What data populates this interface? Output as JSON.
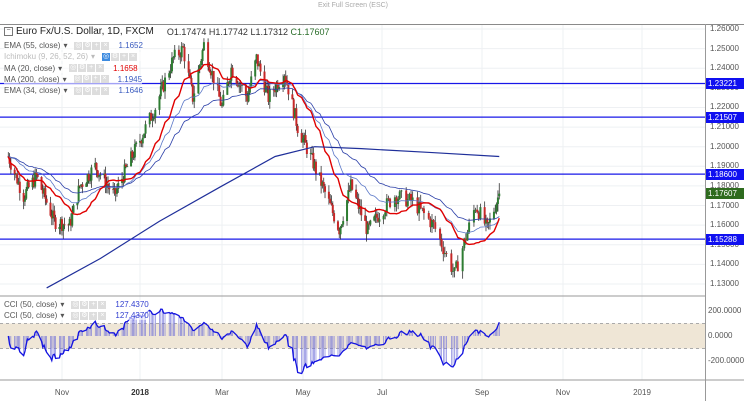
{
  "topbar": {
    "exit_fullscreen": "Exit Full Screen (ESC)"
  },
  "header": {
    "symbol": "Euro Fx/U.S. Dollar, 1D, FXCM",
    "open": "O1.17474",
    "high": "H1.17742",
    "low": "L1.17312",
    "close": "C1.17607"
  },
  "indicators": [
    {
      "label": "EMA (55, close)",
      "value": "1.1652",
      "color": "#3a5bbf",
      "faded": false
    },
    {
      "label": "Ichimoku (9, 26, 52, 26)",
      "value": "",
      "color": "#bbb",
      "faded": true
    },
    {
      "label": "MA (20, close)",
      "value": "1.1658",
      "color": "#e00000",
      "faded": false
    },
    {
      "label": "MA (200, close)",
      "value": "1.1945",
      "color": "#3a5bbf",
      "faded": false
    },
    {
      "label": "EMA (34, close)",
      "value": "1.1646",
      "color": "#3a5bbf",
      "faded": false
    }
  ],
  "cci_legends": [
    {
      "label": "CCI (50, close)",
      "value": "127.4370"
    },
    {
      "label": "CCI (50, close)",
      "value": "127.4370"
    }
  ],
  "price_axis": [
    "1.26000",
    "1.25000",
    "1.24000",
    "1.23000",
    "1.22000",
    "1.21000",
    "1.20000",
    "1.19000",
    "1.18000",
    "1.17000",
    "1.16000",
    "1.15000",
    "1.14000",
    "1.13000"
  ],
  "cci_axis": [
    "200.0000",
    "0.0000",
    "-200.0000"
  ],
  "horizontal_lines": [
    {
      "price": 1.23221,
      "label": "1.23221"
    },
    {
      "price": 1.21507,
      "label": "1.21507"
    },
    {
      "price": 1.186,
      "label": "1.18600"
    },
    {
      "price": 1.15288,
      "label": "1.15288"
    }
  ],
  "last_price": {
    "price": 1.17607,
    "label": "1.17607",
    "color": "#2e6b1e"
  },
  "time_axis": [
    {
      "label": "Nov",
      "date": "2017-11-01",
      "bold": false
    },
    {
      "label": "2018",
      "date": "2018-01-01",
      "bold": true
    },
    {
      "label": "Mar",
      "date": "2018-03-01",
      "bold": false
    },
    {
      "label": "May",
      "date": "2018-05-01",
      "bold": false
    },
    {
      "label": "Jul",
      "date": "2018-07-01",
      "bold": false
    },
    {
      "label": "Sep",
      "date": "2018-09-01",
      "bold": false
    },
    {
      "label": "Nov",
      "date": "2018-11-01",
      "bold": false
    },
    {
      "label": "2019",
      "date": "2019-01-01",
      "bold": false
    }
  ],
  "chart_data": {
    "type": "candlestick",
    "anchors": [
      [
        "2017-09-20",
        1.195
      ],
      [
        "2017-10-02",
        1.175
      ],
      [
        "2017-10-12",
        1.185
      ],
      [
        "2017-10-26",
        1.162
      ],
      [
        "2017-11-07",
        1.16
      ],
      [
        "2017-11-15",
        1.18
      ],
      [
        "2017-11-27",
        1.19
      ],
      [
        "2017-12-12",
        1.175
      ],
      [
        "2017-12-20",
        1.187
      ],
      [
        "2018-01-02",
        1.205
      ],
      [
        "2018-01-12",
        1.22
      ],
      [
        "2018-01-25",
        1.245
      ],
      [
        "2018-02-01",
        1.25
      ],
      [
        "2018-02-08",
        1.225
      ],
      [
        "2018-02-16",
        1.252
      ],
      [
        "2018-03-01",
        1.22
      ],
      [
        "2018-03-08",
        1.24
      ],
      [
        "2018-03-20",
        1.225
      ],
      [
        "2018-03-27",
        1.245
      ],
      [
        "2018-04-05",
        1.225
      ],
      [
        "2018-04-17",
        1.238
      ],
      [
        "2018-04-27",
        1.21
      ],
      [
        "2018-05-10",
        1.19
      ],
      [
        "2018-05-29",
        1.158
      ],
      [
        "2018-06-07",
        1.18
      ],
      [
        "2018-06-20",
        1.157
      ],
      [
        "2018-06-28",
        1.165
      ],
      [
        "2018-07-09",
        1.175
      ],
      [
        "2018-07-20",
        1.172
      ],
      [
        "2018-08-02",
        1.16
      ],
      [
        "2018-08-15",
        1.135
      ],
      [
        "2018-08-28",
        1.17
      ],
      [
        "2018-09-05",
        1.158
      ],
      [
        "2018-09-14",
        1.176
      ]
    ],
    "ma200": [
      [
        "2017-10-20",
        1.128
      ],
      [
        "2017-12-01",
        1.143
      ],
      [
        "2018-01-15",
        1.162
      ],
      [
        "2018-03-01",
        1.18
      ],
      [
        "2018-04-10",
        1.195
      ],
      [
        "2018-05-10",
        1.2
      ],
      [
        "2018-06-15",
        1.199
      ],
      [
        "2018-08-01",
        1.197
      ],
      [
        "2018-09-14",
        1.195
      ]
    ]
  }
}
